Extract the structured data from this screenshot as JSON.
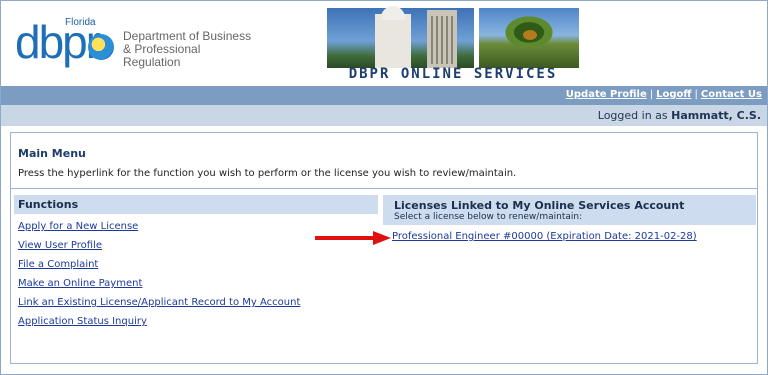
{
  "header": {
    "logo": {
      "florida": "Florida",
      "wordmark": "dbpr",
      "dept_line1": "Department of Business",
      "dept_line2": "& Professional Regulation"
    },
    "banner_title": "DBPR ONLINE SERVICES"
  },
  "nav": {
    "links": [
      {
        "label": "Update Profile"
      },
      {
        "label": "Logoff"
      },
      {
        "label": "Contact Us"
      }
    ],
    "separator": "|"
  },
  "login": {
    "prefix": "Logged in as",
    "user": "Hammatt, C.S."
  },
  "main": {
    "title": "Main Menu",
    "description": "Press the hyperlink for the function you wish to perform or the license you wish to review/maintain."
  },
  "functions": {
    "title": "Functions",
    "items": [
      {
        "label": "Apply for a New License"
      },
      {
        "label": "View User Profile"
      },
      {
        "label": "File a Complaint"
      },
      {
        "label": "Make an Online Payment"
      },
      {
        "label": "Link an Existing License/Applicant Record to My Account"
      },
      {
        "label": "Application Status Inquiry"
      }
    ]
  },
  "licenses": {
    "title": "Licenses Linked to My Online Services Account",
    "subtitle": "Select a license below to renew/maintain:",
    "items": [
      {
        "label": "Professional Engineer #00000 (Expiration Date: 2021-02-28)"
      }
    ]
  },
  "colors": {
    "nav_bar": "#7c9cc2",
    "login_bar": "#c9d6e6",
    "section_header": "#cddcee",
    "link": "#1d3a9a",
    "arrow": "#e01010"
  }
}
